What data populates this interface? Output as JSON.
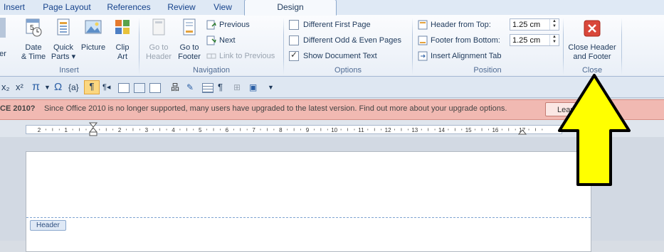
{
  "tabs": [
    "Insert",
    "Page Layout",
    "References",
    "Review",
    "View",
    "Design"
  ],
  "active_tab": "Design",
  "insert_group": {
    "label": "Insert",
    "partial_label_line1": "er",
    "buttons": [
      {
        "line1": "Date",
        "line2": "& Time",
        "icon": "calendar-clock-icon"
      },
      {
        "line1": "Quick",
        "line2": "Parts ▾",
        "icon": "quick-parts-icon"
      },
      {
        "line1": "Picture",
        "line2": "",
        "icon": "picture-icon"
      },
      {
        "line1": "Clip",
        "line2": "Art",
        "icon": "clip-art-icon"
      }
    ]
  },
  "navigation_group": {
    "label": "Navigation",
    "go_to_header": {
      "line1": "Go to",
      "line2": "Header"
    },
    "go_to_footer": {
      "line1": "Go to",
      "line2": "Footer"
    },
    "previous": "Previous",
    "next": "Next",
    "link_to_previous": "Link to Previous"
  },
  "options_group": {
    "label": "Options",
    "items": [
      {
        "label": "Different First Page",
        "checked": false
      },
      {
        "label": "Different Odd & Even Pages",
        "checked": false
      },
      {
        "label": "Show Document Text",
        "checked": true
      }
    ]
  },
  "position_group": {
    "label": "Position",
    "header_from_top": {
      "label": "Header from Top:",
      "value": "1.25 cm"
    },
    "footer_from_bottom": {
      "label": "Footer from Bottom:",
      "value": "1.25 cm"
    },
    "insert_alignment_tab": "Insert Alignment Tab"
  },
  "close_group": {
    "label": "Close",
    "button_line1": "Close Header",
    "button_line2": "and Footer"
  },
  "quick_toolbar": {
    "subscript": "x₂",
    "superscript": "x²",
    "pi": "π",
    "omega": "Ω",
    "field": "{a}",
    "pilcrow": "¶"
  },
  "message_bar": {
    "title": "CE 2010?",
    "text": "Since Office 2010 is no longer supported, many users have upgraded to the latest version. Find out more about your upgrade options.",
    "button": "Learn"
  },
  "ruler": {
    "numbers": [
      "2",
      "1",
      "1",
      "2",
      "3",
      "4",
      "5",
      "6",
      "7",
      "8",
      "9",
      "10",
      "11",
      "12",
      "13",
      "14",
      "15",
      "16",
      "17"
    ]
  },
  "document": {
    "header_tag": "Header"
  },
  "annotation": {
    "color": "#ffff00",
    "outline": "#000000"
  }
}
